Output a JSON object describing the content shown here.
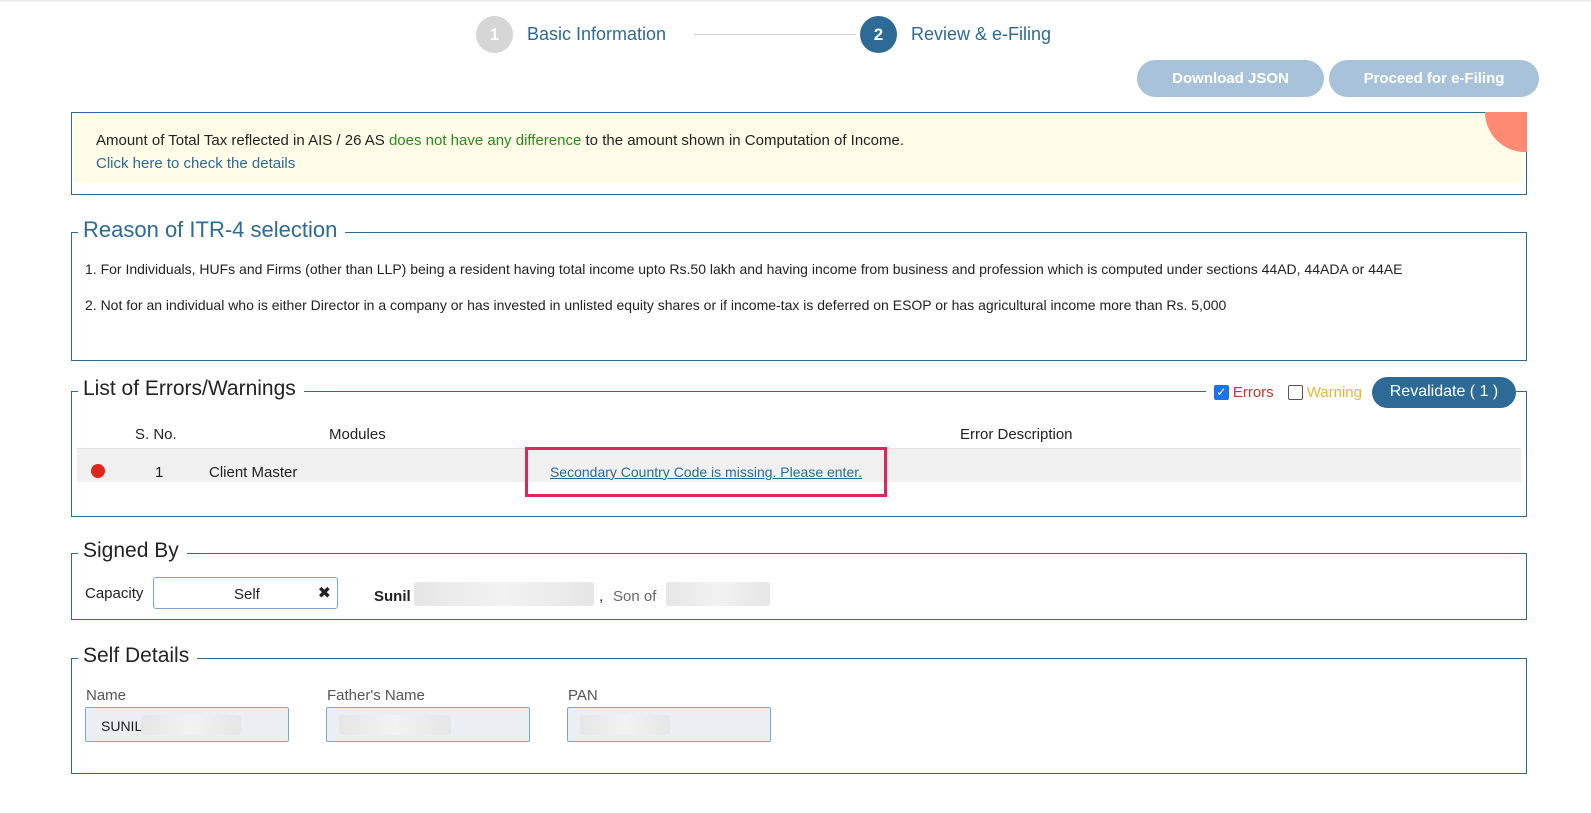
{
  "stepper": {
    "step1": {
      "number": "1",
      "label": "Basic Information"
    },
    "step2": {
      "number": "2",
      "label": "Review & e-Filing"
    }
  },
  "actions": {
    "download_json": "Download JSON",
    "proceed_efiling": "Proceed for e-Filing"
  },
  "tax_notice": {
    "text_before": "Amount of Total Tax reflected in AIS / 26 AS ",
    "highlight": "does not have any difference",
    "text_after": " to the amount shown in Computation of Income.",
    "link": "Click here to check the details"
  },
  "reason": {
    "title": "Reason of ITR-4 selection",
    "lines": [
      "1. For Individuals, HUFs and Firms (other than LLP) being a resident having total income upto Rs.50 lakh and having income from business and profession which is computed under sections 44AD, 44ADA or 44AE",
      "2. Not for an individual who is either Director in a company or has invested in unlisted equity shares or if income-tax is deferred on ESOP or has agricultural income more than Rs. 5,000"
    ]
  },
  "errors": {
    "title": "List of Errors/Warnings",
    "filter_errors": "Errors",
    "filter_warning": "Warning",
    "revalidate": "Revalidate ( 1 )",
    "columns": {
      "sno": "S. No.",
      "modules": "Modules",
      "description": "Error Description"
    },
    "rows": [
      {
        "sno": "1",
        "module": "Client Master",
        "description": "Secondary Country Code is missing. Please enter."
      }
    ]
  },
  "signed_by": {
    "title": "Signed By",
    "capacity_label": "Capacity",
    "capacity_value": "Self",
    "name": "Sunil",
    "comma": ",",
    "son_of": "Son of"
  },
  "self_details": {
    "title": "Self Details",
    "name_label": "Name",
    "name_value": "SUNIL",
    "father_label": "Father's Name",
    "pan_label": "PAN"
  },
  "colors": {
    "primary": "#2d6a96",
    "disabled_button": "#a8c3d9",
    "error_red": "#e0261b",
    "warning_yellow": "#e6b82e",
    "highlight_green": "#2a8a1f"
  }
}
